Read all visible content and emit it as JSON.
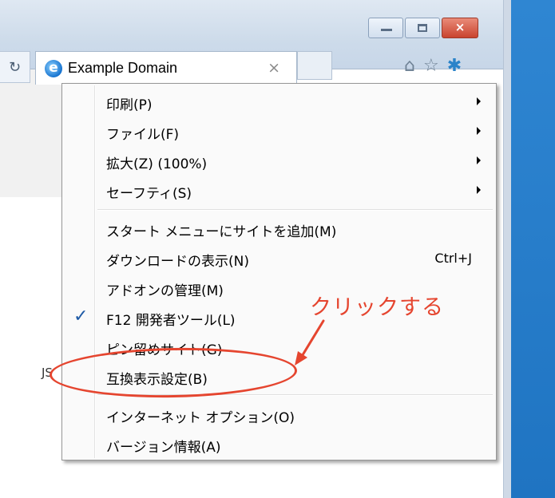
{
  "window": {
    "tab_title": "Example Domain",
    "tab_close_glyph": "×",
    "refresh_glyph": "↻",
    "buttons": {
      "minimize": "minimize",
      "maximize": "maximize",
      "close_glyph": "×"
    }
  },
  "toolbar_icons": [
    "home-icon",
    "star-icon",
    "gear-icon"
  ],
  "toolbar_glyphs": {
    "home": "⌂",
    "star": "☆",
    "gear": "✱"
  },
  "menu": {
    "items": [
      {
        "label": "印刷(P)",
        "submenu": true
      },
      {
        "label": "ファイル(F)",
        "submenu": true
      },
      {
        "label": "拡大(Z) (100%)",
        "submenu": true
      },
      {
        "label": "セーフティ(S)",
        "submenu": true
      },
      {
        "label": "スタート メニューにサイトを追加(M)"
      },
      {
        "label": "ダウンロードの表示(N)",
        "shortcut": "Ctrl+J"
      },
      {
        "label": "アドオンの管理(M)"
      },
      {
        "label": "F12 開発者ツール(L)",
        "checked": true,
        "check_glyph": "✓"
      },
      {
        "label": "ピン留めサイト(G)"
      },
      {
        "label": "互換表示設定(B)",
        "highlighted_by_annotation": true
      },
      {
        "label": "インターネット オプション(O)"
      },
      {
        "label": "バージョン情報(A)"
      }
    ]
  },
  "annotation": {
    "text": "クリックする",
    "color": "#e5452f"
  },
  "side_fragment": "JS",
  "colors": {
    "desktop": "#2a7ecb",
    "accent_red": "#e5452f",
    "check_blue": "#1e5aa6"
  }
}
